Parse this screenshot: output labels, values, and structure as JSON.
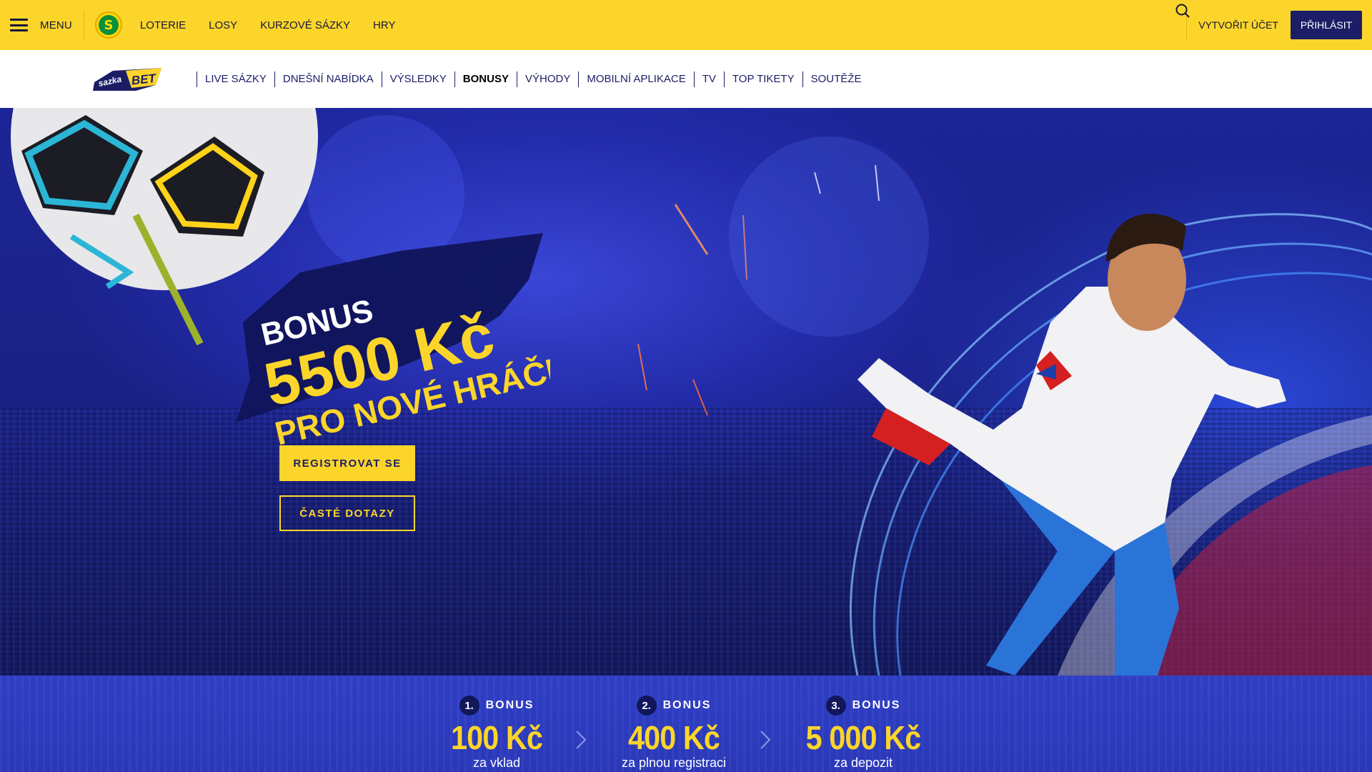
{
  "topbar": {
    "menu_label": "MENU",
    "nav": [
      "LOTERIE",
      "LOSY",
      "KURZOVÉ SÁZKY",
      "HRY"
    ],
    "create_account": "VYTVOŘIT ÚČET",
    "login": "PŘIHLÁSIT"
  },
  "subnav": {
    "items": [
      "LIVE SÁZKY",
      "DNEŠNÍ NABÍDKA",
      "VÝSLEDKY",
      "BONUSY",
      "VÝHODY",
      "MOBILNÍ APLIKACE",
      "TV",
      "TOP TIKETY",
      "SOUTĚŽE"
    ],
    "active": "BONUSY"
  },
  "hero": {
    "line1": "BONUS",
    "line2": "5500 Kč",
    "line3": "PRO NOVÉ HRÁČE",
    "register_button": "REGISTROVAT SE",
    "faq_button": "ČASTÉ DOTAZY"
  },
  "bonuses": [
    {
      "num": "1.",
      "word": "BONUS",
      "amount": "100 Kč",
      "sub": "za vklad"
    },
    {
      "num": "2.",
      "word": "BONUS",
      "amount": "400 Kč",
      "sub": "za plnou registraci"
    },
    {
      "num": "3.",
      "word": "BONUS",
      "amount": "5 000 Kč",
      "sub": "za depozit"
    }
  ],
  "colors": {
    "brand_yellow": "#fcd52a",
    "brand_navy": "#1b1e66",
    "hero_blue": "#1c2596"
  }
}
